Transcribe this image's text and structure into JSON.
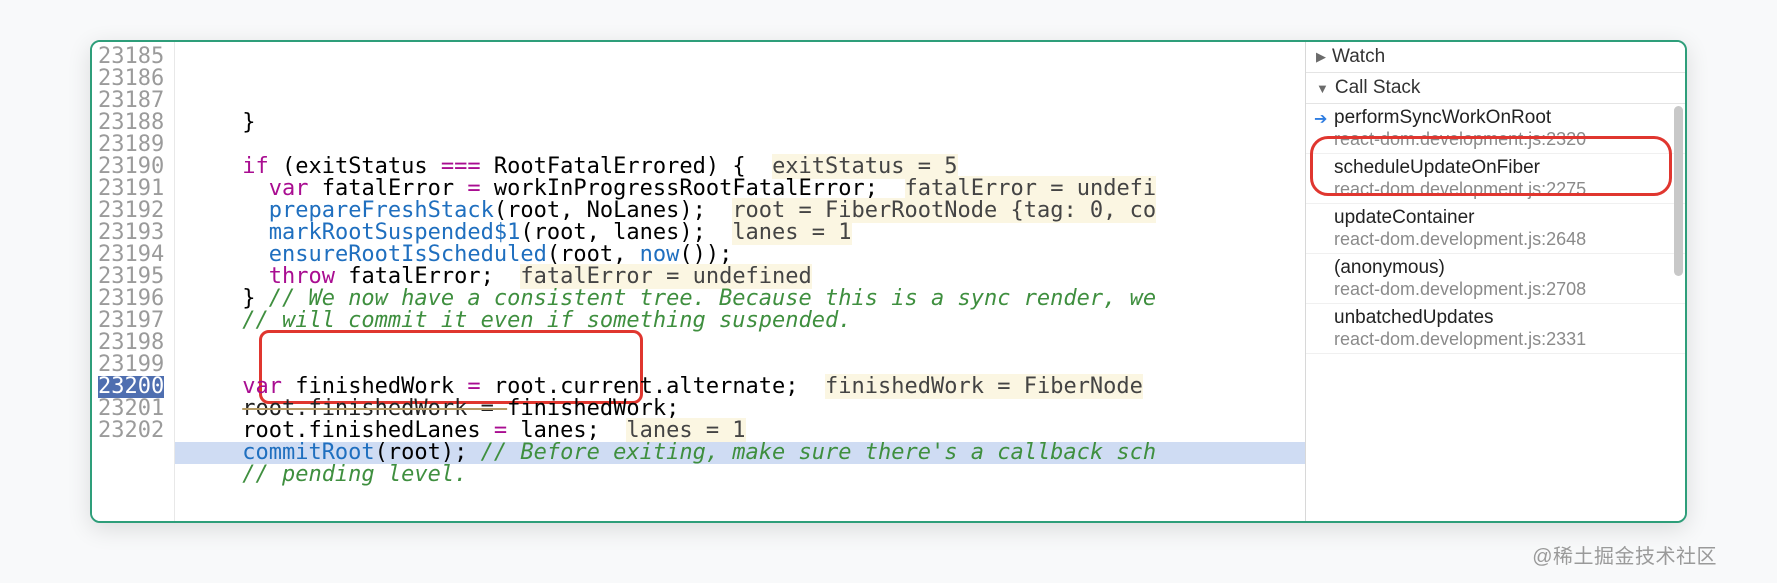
{
  "watermark": "@稀土掘金技术社区",
  "editor": {
    "active_line": 23200,
    "lines": [
      {
        "num": 23185,
        "html": "<span class='pl'>    }</span>"
      },
      {
        "num": 23186,
        "html": ""
      },
      {
        "num": 23187,
        "html": "<span class='pl'>    </span><span class='k'>if</span><span class='pl'> (exitStatus </span><span class='op'>===</span><span class='pl'> RootFatalErrored) {  </span><span class='hint'>exitStatus = 5</span>"
      },
      {
        "num": 23188,
        "html": "<span class='pl'>      </span><span class='k'>var</span><span class='pl'> fatalError </span><span class='op'>=</span><span class='pl'> workInProgressRootFatalError;  </span><span class='hint'>fatalError = undefi</span>"
      },
      {
        "num": 23189,
        "html": "<span class='pl'>      </span><span class='fn'>prepareFreshStack</span><span class='pl'>(root, NoLanes);  </span><span class='hint'>root = FiberRootNode {tag: 0, co</span>"
      },
      {
        "num": 23190,
        "html": "<span class='pl'>      </span><span class='fn'>markRootSuspended$1</span><span class='pl'>(root, lanes);  </span><span class='hint'>lanes = 1</span>"
      },
      {
        "num": 23191,
        "html": "<span class='pl'>      </span><span class='fn'>ensureRootIsScheduled</span><span class='pl'>(root, </span><span class='fn'>now</span><span class='pl'>());</span>"
      },
      {
        "num": 23192,
        "html": "<span class='pl'>      </span><span class='k'>throw</span><span class='pl'> fatalError;  </span><span class='hint'>fatalError = undefined</span>"
      },
      {
        "num": 23193,
        "html": "<span class='pl'>    } </span><span class='cm'>// We now have a consistent tree. Because this is a sync render, we</span>"
      },
      {
        "num": 23194,
        "html": "<span class='pl'>    </span><span class='cm'>// will commit it even if something suspended.</span>"
      },
      {
        "num": 23195,
        "html": ""
      },
      {
        "num": 23196,
        "html": ""
      },
      {
        "num": 23197,
        "html": "<span class='pl'>    </span><span class='k'>var</span><span class='pl'> finishedWork </span><span class='op'>=</span><span class='pl'> root.current.alternate;  </span><span class='hint'>finishedWork = FiberNode</span>"
      },
      {
        "num": 23198,
        "html": "<span class='pl'>    </span><span class='strike'>root.finishedWork = </span><span class='pl'>finishedWork;</span>"
      },
      {
        "num": 23199,
        "html": "<span class='pl'>    root.finishedLanes </span><span class='op'>=</span><span class='pl'> lanes;  </span><span class='hint'>lanes = 1</span>"
      },
      {
        "num": 23200,
        "html": "<span class='pl'>    </span><span class='fn'>commitRoot</span><span class='pl'>(root); </span><span class='cm'>// Before exiting, make sure there's a callback sch</span>"
      },
      {
        "num": 23201,
        "html": "<span class='pl'>    </span><span class='cm'>// pending level.</span>"
      },
      {
        "num": 23202,
        "html": ""
      }
    ]
  },
  "sidebar": {
    "watch_label": "Watch",
    "callstack_label": "Call Stack",
    "frames": [
      {
        "name": "performSyncWorkOnRoot",
        "loc": "react-dom.development.js:2320",
        "active": true
      },
      {
        "name": "scheduleUpdateOnFiber",
        "loc": "react-dom.development.js:2275"
      },
      {
        "name": "updateContainer",
        "loc": "react-dom.development.js:2648"
      },
      {
        "name": "(anonymous)",
        "loc": "react-dom.development.js:2708"
      },
      {
        "name": "unbatchedUpdates",
        "loc": "react-dom.development.js:2331"
      }
    ]
  }
}
